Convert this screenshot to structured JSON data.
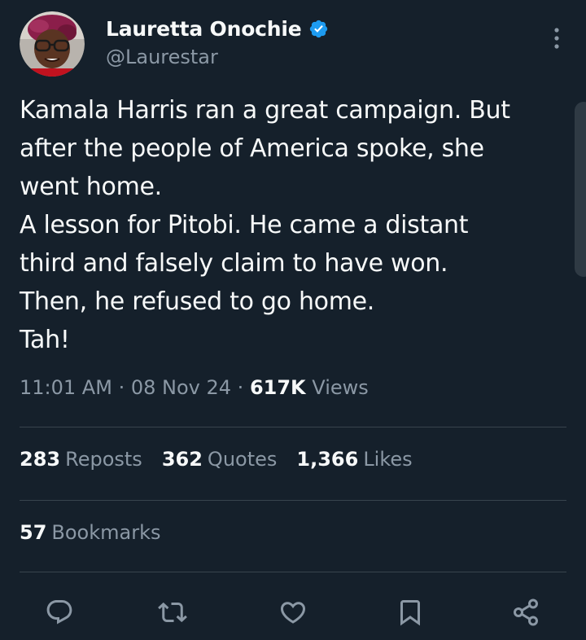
{
  "author": {
    "display_name": "Lauretta Onochie",
    "handle": "@Laurestar",
    "verified": true
  },
  "tweet": {
    "lines": [
      "Kamala Harris ran a great campaign. But",
      "after the people of America spoke, she",
      "went home.",
      "A lesson for Pitobi. He came a distant",
      "third and falsely claim to have won.",
      "Then, he refused to go home.",
      "Tah!"
    ]
  },
  "meta": {
    "time": "11:01 AM",
    "separator": "·",
    "date": "08 Nov 24",
    "views_count": "617K",
    "views_label": "Views"
  },
  "stats": {
    "reposts_count": "283",
    "reposts_label": "Reposts",
    "quotes_count": "362",
    "quotes_label": "Quotes",
    "likes_count": "1,366",
    "likes_label": "Likes",
    "bookmarks_count": "57",
    "bookmarks_label": "Bookmarks"
  },
  "actions": {
    "icons": [
      "reply-icon",
      "repost-icon",
      "like-icon",
      "bookmark-icon",
      "share-icon"
    ]
  },
  "colors": {
    "background": "#15202b",
    "text": "#f7f9f9",
    "secondary": "#8b98a5",
    "divider": "#38444d",
    "verified": "#1d9bf0"
  }
}
